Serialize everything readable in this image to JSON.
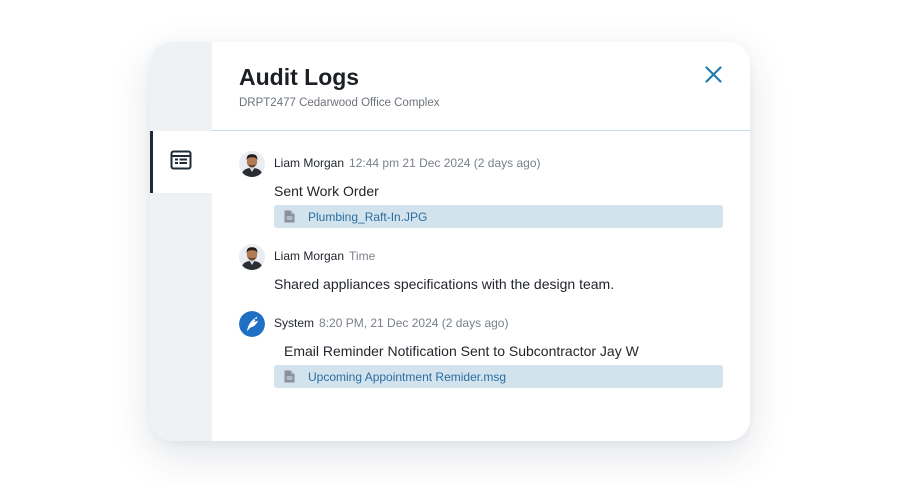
{
  "header": {
    "title": "Audit Logs",
    "subtitle": "DRPT2477 Cedarwood Office Complex"
  },
  "sidebar": {
    "active_tab_icon": "list-view-icon"
  },
  "colors": {
    "accent": "#1f7cab",
    "attachment_bg": "#d3e3ee",
    "attachment_text": "#2b6d9e",
    "rail_bg": "#eef2f5"
  },
  "entries": [
    {
      "author": "Liam Morgan",
      "time": "12:44 pm 21 Dec 2024 (2 days ago)",
      "message": "Sent Work Order",
      "attachment": "Plumbing_Raft-In.JPG",
      "avatar": "user-photo"
    },
    {
      "author": "Liam Morgan",
      "time": "Time",
      "message": "Shared appliances specifications with the design team.",
      "avatar": "user-photo"
    },
    {
      "author": "System",
      "time": "8:20 PM, 21 Dec 2024 (2 days ago)",
      "message": "Email Reminder Notification Sent to Subcontractor Jay W",
      "attachment": "Upcoming Appointment Remider.msg",
      "avatar": "system-bird-logo"
    }
  ]
}
